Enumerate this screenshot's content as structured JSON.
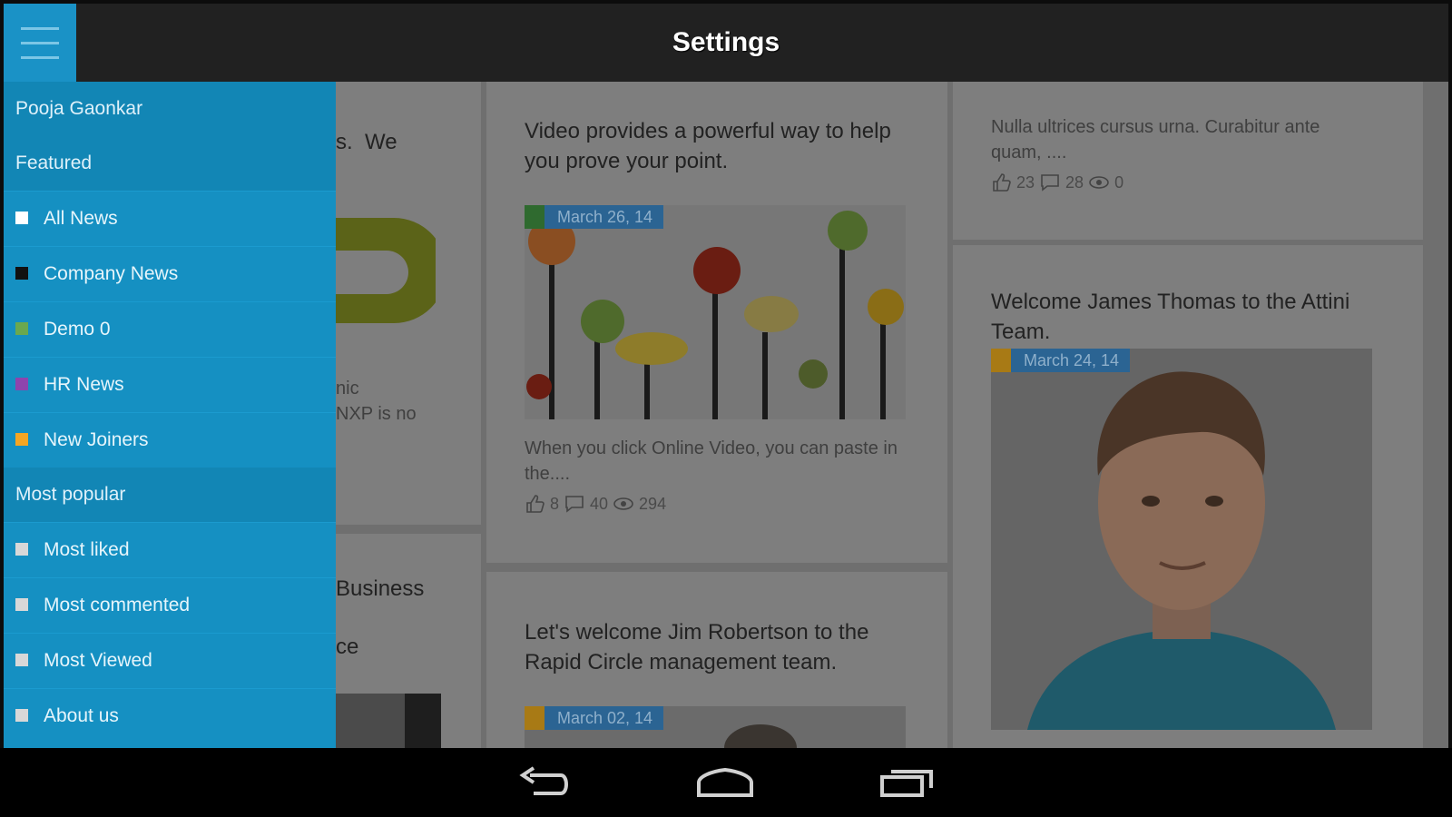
{
  "app": {
    "title": "Settings"
  },
  "drawer": {
    "user_name": "Pooja Gaonkar",
    "featured_label": "Featured",
    "categories": [
      {
        "label": "All News",
        "color": "#ffffff"
      },
      {
        "label": "Company News",
        "color": "#111111"
      },
      {
        "label": "Demo 0",
        "color": "#6aa84f"
      },
      {
        "label": "HR News",
        "color": "#8e44ad"
      },
      {
        "label": "New Joiners",
        "color": "#f5a623"
      }
    ],
    "popular_label": "Most popular",
    "popular": [
      {
        "label": "Most liked",
        "color": "#d8d8d8"
      },
      {
        "label": "Most commented",
        "color": "#d8d8d8"
      },
      {
        "label": "Most Viewed",
        "color": "#d8d8d8"
      },
      {
        "label": "About us",
        "color": "#d8d8d8"
      }
    ]
  },
  "cards": {
    "left_top": {
      "title_fragment": "s.  We",
      "text1": "nic",
      "text2": "NXP is no"
    },
    "left_bottom": {
      "line1": "Business",
      "line2": "ce"
    },
    "video": {
      "title": "Video provides a powerful way to help you prove your point.",
      "date": "March 26, 14",
      "category_color": "#2f7a2f",
      "excerpt": "When you click Online Video, you can paste in the....",
      "likes": "8",
      "comments": "40",
      "views": "294"
    },
    "jim": {
      "title": "Let's welcome Jim Robertson to the Rapid Circle management team.",
      "date": "March 02, 14",
      "category_color": "#b98a1c"
    },
    "nulla": {
      "excerpt": "Nulla ultrices cursus urna. Curabitur ante quam, ....",
      "likes": "23",
      "comments": "28",
      "views": "0"
    },
    "james": {
      "title": "Welcome James Thomas to the Attini Team.",
      "date": "March 24, 14",
      "category_color": "#b98a1c"
    }
  },
  "navbar": {
    "back_icon": "back-icon",
    "home_icon": "home-icon",
    "recents_icon": "recents-icon"
  }
}
